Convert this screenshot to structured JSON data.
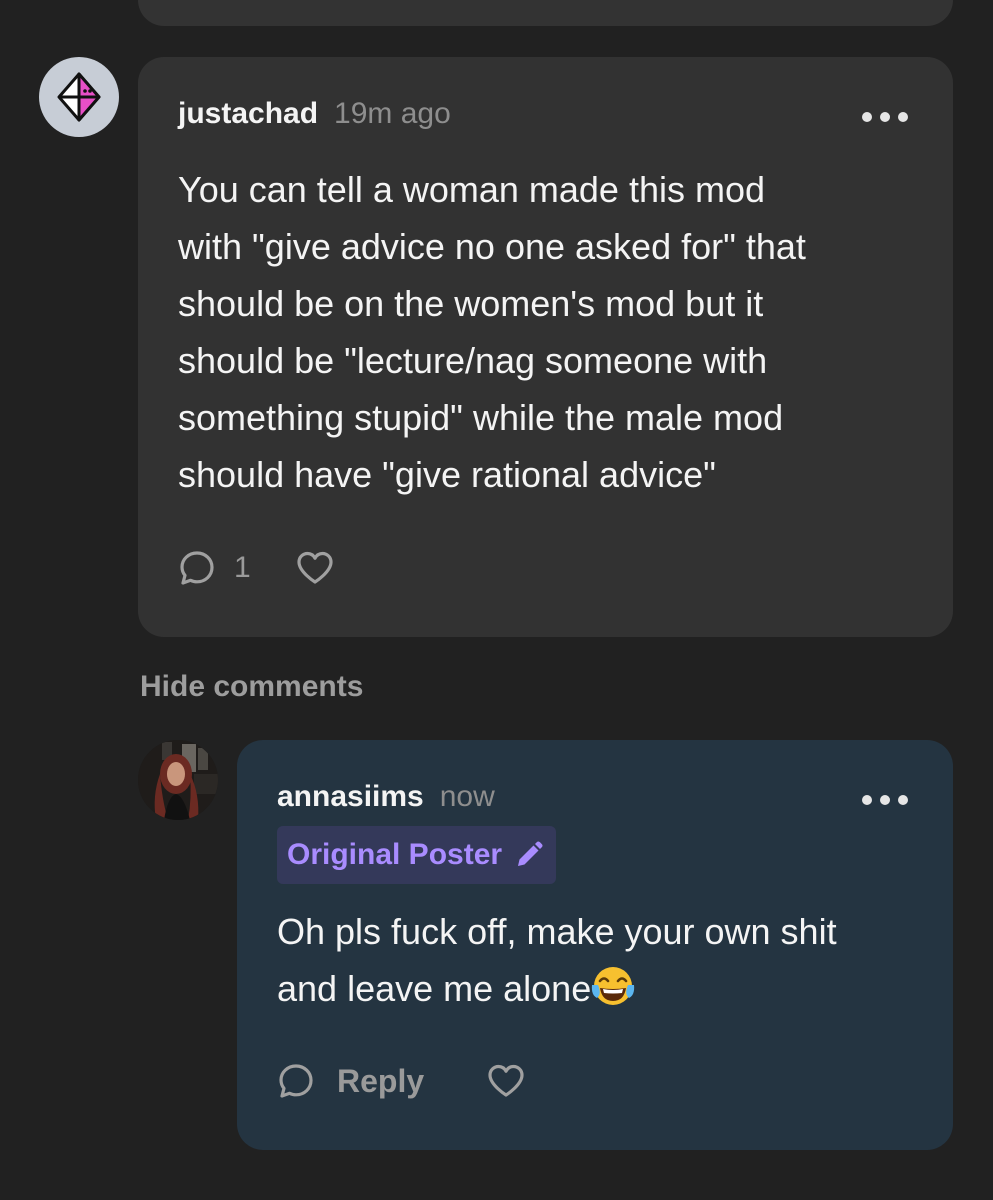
{
  "comment": {
    "username": "justachad",
    "timestamp": "19m ago",
    "lines": [
      "You can tell a woman made this mod",
      "with \"give advice no one asked for\" that",
      "should be on the women's mod but it",
      "should be \"lecture/nag someone with",
      "something stupid\" while the male mod",
      "should have \"give rational advice\""
    ],
    "reply_count": "1",
    "icons": {
      "avatar": "pink-diamond-logo-icon",
      "menu": "more-dots-icon",
      "reply": "speech-bubble-icon",
      "like": "heart-icon"
    }
  },
  "thread": {
    "hide_label": "Hide comments"
  },
  "reply": {
    "username": "annasiims",
    "timestamp": "now",
    "badge": "Original Poster",
    "lines": [
      "Oh pls fuck off, make your own shit",
      "and leave me alone"
    ],
    "reply_label": "Reply",
    "icons": {
      "badge": "pencil-icon",
      "emoji": "tears-of-joy-emoji",
      "reply": "speech-bubble-icon",
      "like": "heart-icon"
    }
  },
  "colors": {
    "background": "#212121",
    "comment_card": "#323232",
    "reply_card": "#243441",
    "badge_bg": "#34395a",
    "badge_text": "#a98cff",
    "muted_text": "#9a9a9a"
  }
}
